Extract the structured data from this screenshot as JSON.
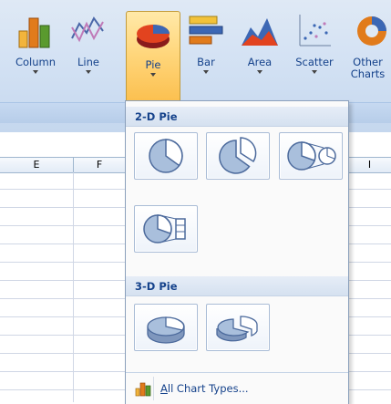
{
  "ribbon": {
    "buttons": [
      {
        "label": "Column",
        "icon": "column-chart-icon"
      },
      {
        "label": "Line",
        "icon": "line-chart-icon"
      },
      {
        "label": "Pie",
        "icon": "pie-chart-icon",
        "active": true
      },
      {
        "label": "Bar",
        "icon": "bar-chart-icon"
      },
      {
        "label": "Area",
        "icon": "area-chart-icon"
      },
      {
        "label": "Scatter",
        "icon": "scatter-chart-icon"
      },
      {
        "label_line1": "Other",
        "label_line2": "Charts",
        "icon": "other-charts-icon"
      }
    ]
  },
  "sheet": {
    "columns": [
      "E",
      "F",
      "I"
    ]
  },
  "dropdown": {
    "section_2d": "2-D Pie",
    "section_3d": "3-D Pie",
    "tiles_2d": [
      "pie",
      "exploded-pie",
      "pie-of-pie",
      "bar-of-pie"
    ],
    "tiles_3d": [
      "3d-pie",
      "exploded-3d-pie"
    ],
    "footer_label": "All Chart Types..."
  },
  "colors": {
    "ribbon_text": "#15428b",
    "active_button": "#ffd67b",
    "pie_fill": "#a9bfdc",
    "pie_slice": "#3c5c95"
  }
}
